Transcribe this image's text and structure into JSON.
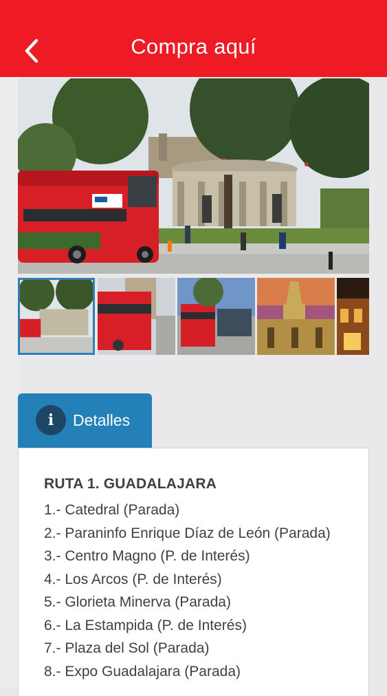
{
  "header": {
    "title": "Compra aquí",
    "back_icon": "chevron-left-icon",
    "background": "#ee1b24"
  },
  "gallery": {
    "thumbnails": [
      {
        "name": "thumbnail-rotonda-bus",
        "selected": true
      },
      {
        "name": "thumbnail-bus-street"
      },
      {
        "name": "thumbnail-bus-plaza"
      },
      {
        "name": "thumbnail-cathedral"
      },
      {
        "name": "thumbnail-night-building"
      }
    ]
  },
  "tab": {
    "label": "Detalles",
    "icon": "info-icon",
    "icon_glyph": "i",
    "color": "#2481b8"
  },
  "details": {
    "title": "RUTA 1. GUADALAJARA",
    "stops": [
      "1.- Catedral (Parada)",
      "2.- Paraninfo Enrique Díaz de León (Parada)",
      "3.- Centro Magno (P. de Interés)",
      "4.- Los Arcos (P. de Interés)",
      "5.- Glorieta Minerva (Parada)",
      "6.- La Estampida (P. de Interés)",
      "7.- Plaza del Sol (Parada)",
      "8.- Expo Guadalajara (Parada)"
    ]
  }
}
